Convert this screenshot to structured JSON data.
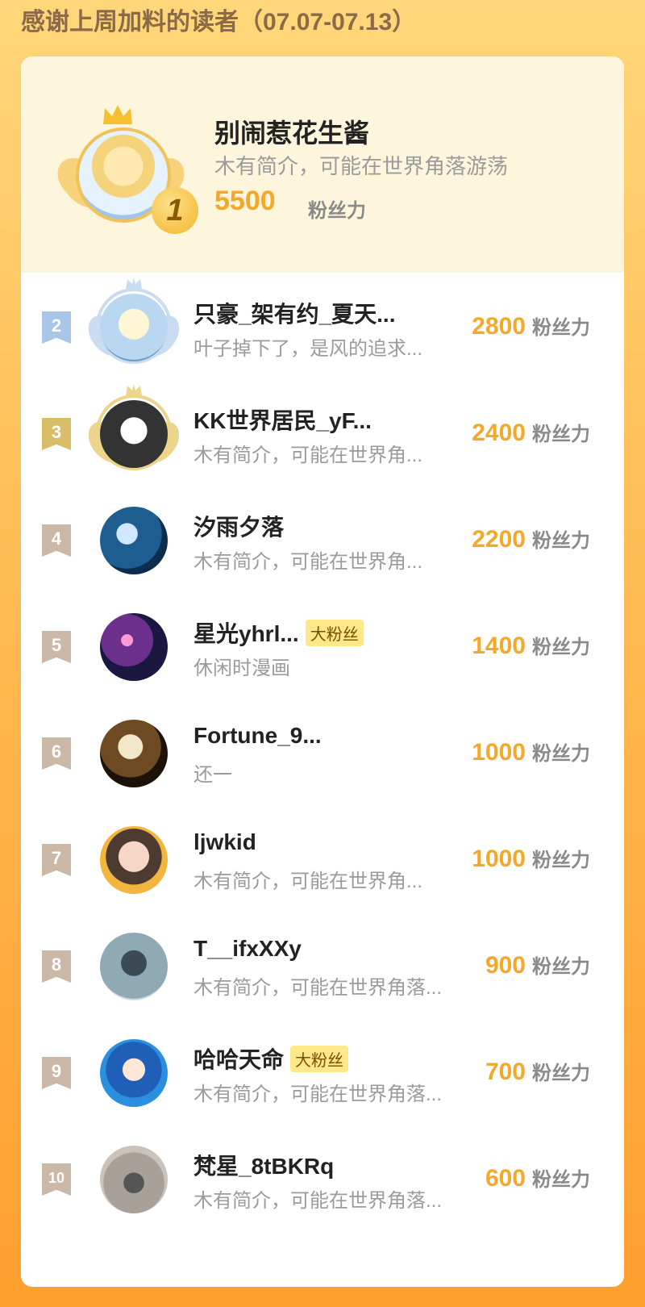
{
  "header": {
    "title": "感谢上周加料的读者（07.07-07.13）"
  },
  "unit_label": "粉丝力",
  "tag_label": "大粉丝",
  "colors": {
    "accent": "#f4a82a",
    "rank2": "#a9c6e8",
    "rank3": "#d8be66",
    "rankN": "#cbb8a6"
  },
  "top": {
    "rank": "1",
    "name": "别闹惹花生酱",
    "bio": "木有简介，可能在世界角落游荡",
    "score": "5500"
  },
  "readers": [
    {
      "rank": "2",
      "name": "只豪_架有约_夏天...",
      "bio": "叶子掉下了，是风的追求...",
      "score": "2800",
      "tag": ""
    },
    {
      "rank": "3",
      "name": "KK世界居民_yF...",
      "bio": "木有简介，可能在世界角...",
      "score": "2400",
      "tag": ""
    },
    {
      "rank": "4",
      "name": "汐雨夕落",
      "bio": "木有简介，可能在世界角...",
      "score": "2200",
      "tag": ""
    },
    {
      "rank": "5",
      "name": "星光yhrl...",
      "bio": "休闲时漫画",
      "score": "1400",
      "tag": "大粉丝"
    },
    {
      "rank": "6",
      "name": "Fortune_9...",
      "bio": "还一",
      "score": "1000",
      "tag": ""
    },
    {
      "rank": "7",
      "name": "ljwkid",
      "bio": "木有简介，可能在世界角...",
      "score": "1000",
      "tag": ""
    },
    {
      "rank": "8",
      "name": "T__ifxXXy",
      "bio": "木有简介，可能在世界角落...",
      "score": "900",
      "tag": ""
    },
    {
      "rank": "9",
      "name": "哈哈天命",
      "bio": "木有简介，可能在世界角落...",
      "score": "700",
      "tag": "大粉丝"
    },
    {
      "rank": "10",
      "name": "梵星_8tBKRq",
      "bio": "木有简介，可能在世界角落...",
      "score": "600",
      "tag": ""
    }
  ]
}
